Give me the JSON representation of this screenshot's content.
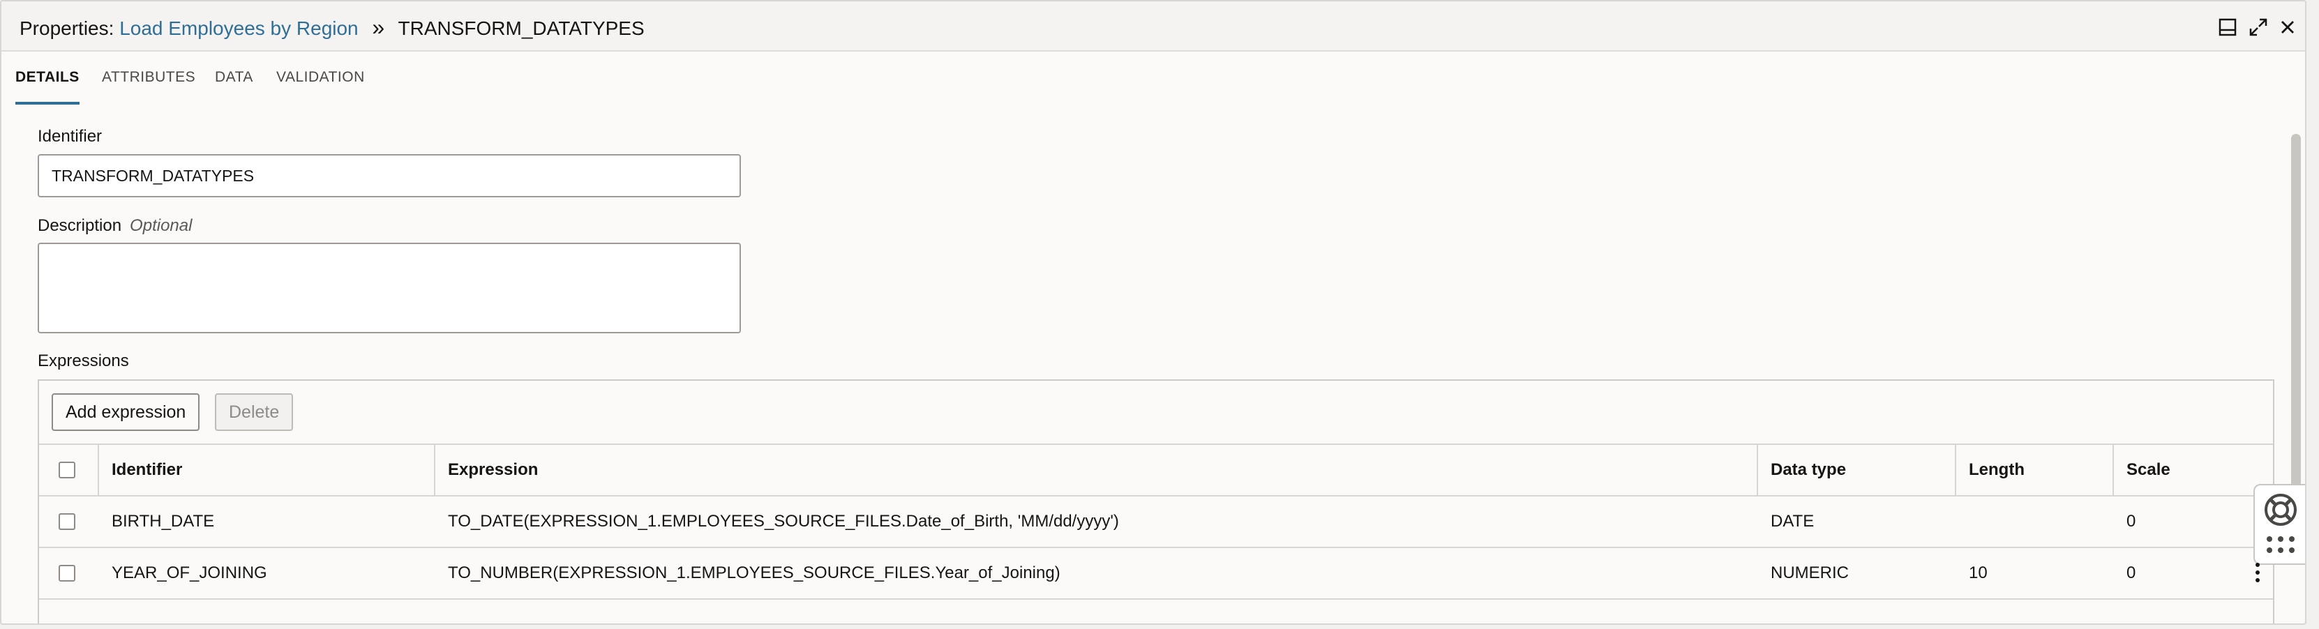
{
  "titlebar": {
    "prefix": "Properties:",
    "link": "Load Employees by Region",
    "separator": "»",
    "current": "TRANSFORM_DATATYPES"
  },
  "window_controls": [
    "dock-icon",
    "expand-icon",
    "close-icon"
  ],
  "tabs": [
    {
      "label": "DETAILS",
      "active": true
    },
    {
      "label": "ATTRIBUTES",
      "active": false
    },
    {
      "label": "DATA",
      "active": false
    },
    {
      "label": "VALIDATION",
      "active": false
    }
  ],
  "form": {
    "identifier_label": "Identifier",
    "identifier_value": "TRANSFORM_DATATYPES",
    "description_label": "Description",
    "description_optional": "Optional",
    "description_value": ""
  },
  "expressions": {
    "label": "Expressions",
    "add_button": "Add expression",
    "delete_button": "Delete",
    "columns": [
      "Identifier",
      "Expression",
      "Data type",
      "Length",
      "Scale"
    ],
    "rows": [
      {
        "identifier": "BIRTH_DATE",
        "expression": "TO_DATE(EXPRESSION_1.EMPLOYEES_SOURCE_FILES.Date_of_Birth, 'MM/dd/yyyy')",
        "data_type": "DATE",
        "length": "",
        "scale": "0"
      },
      {
        "identifier": "YEAR_OF_JOINING",
        "expression": "TO_NUMBER(EXPRESSION_1.EMPLOYEES_SOURCE_FILES.Year_of_Joining)",
        "data_type": "NUMERIC",
        "length": "10",
        "scale": "0"
      }
    ]
  },
  "colors": {
    "accent": "#2f6f97",
    "border": "#d8d6d2",
    "background": "#fbfaf8"
  }
}
